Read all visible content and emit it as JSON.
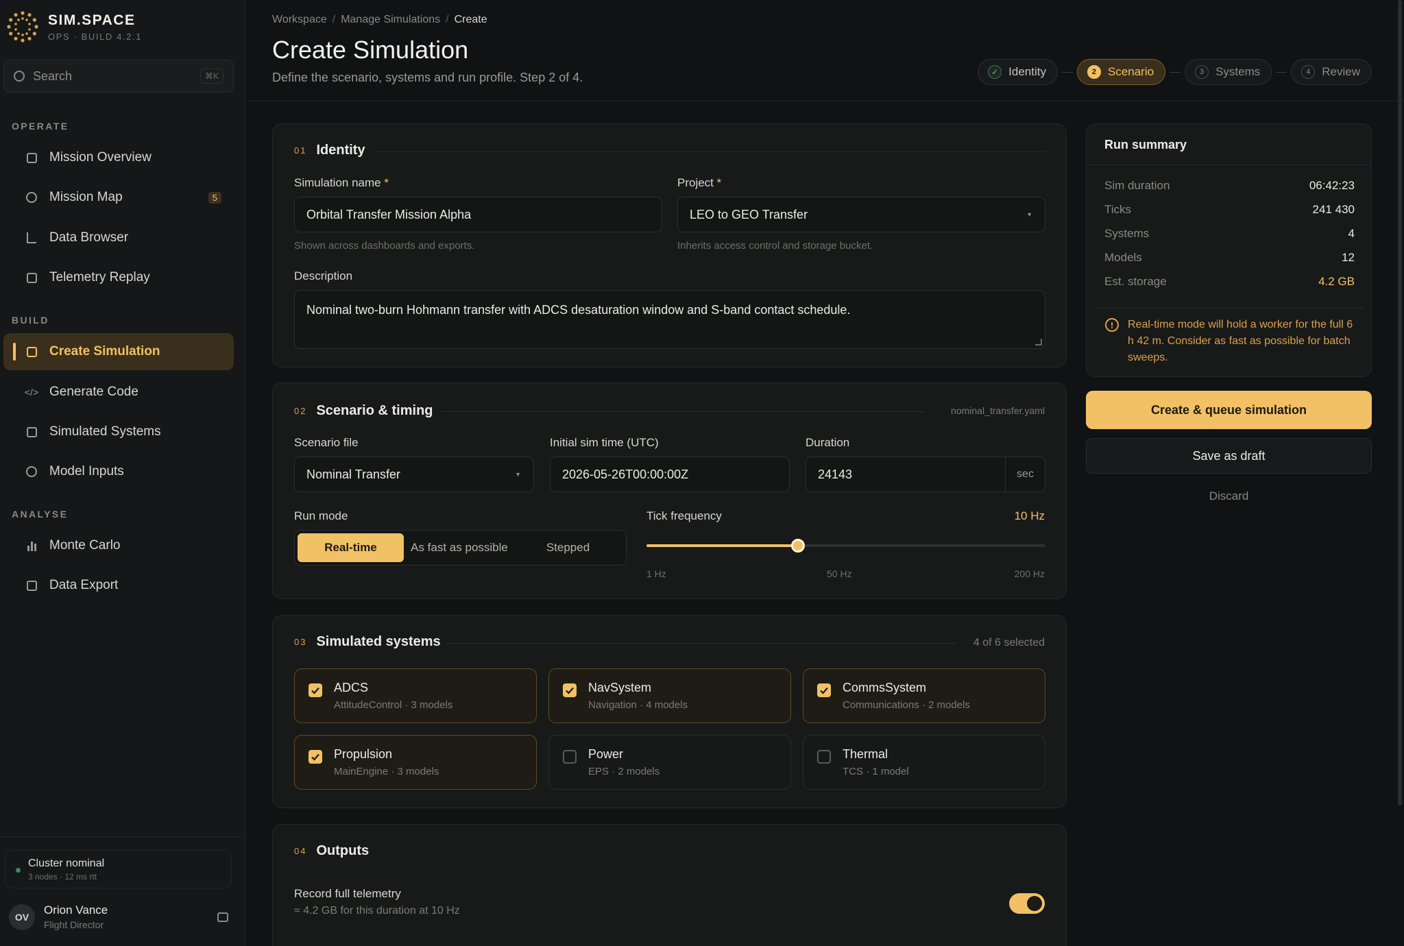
{
  "brand": {
    "name": "SIM.SPACE",
    "sub": "OPS · BUILD 4.2.1"
  },
  "search": {
    "placeholder": "Search",
    "shortcut": "⌘K"
  },
  "nav": {
    "operate": "OPERATE",
    "build": "BUILD",
    "analyse": "ANALYSE",
    "items": [
      {
        "label": "Mission Overview",
        "icon": "square-icon"
      },
      {
        "label": "Mission Map",
        "icon": "circle-icon",
        "badge": "5"
      },
      {
        "label": "Data Browser",
        "icon": "corner-icon"
      },
      {
        "label": "Telemetry Replay",
        "icon": "square-icon"
      },
      {
        "label": "Create Simulation",
        "icon": "square-icon",
        "active": true
      },
      {
        "label": "Generate Code",
        "icon": "code-icon",
        "icon_glyph": "</>"
      },
      {
        "label": "Simulated Systems",
        "icon": "square-icon"
      },
      {
        "label": "Model Inputs",
        "icon": "circle-icon"
      },
      {
        "label": "Monte Carlo",
        "icon": "bar-chart-icon"
      },
      {
        "label": "Data Export",
        "icon": "square-icon"
      }
    ]
  },
  "cluster": {
    "title": "Cluster nominal",
    "sub": "3 nodes · 12 ms rtt",
    "status_color": "#3b8d5a"
  },
  "user": {
    "initials": "OV",
    "name": "Orion Vance",
    "role": "Flight Director"
  },
  "breadcrumb": [
    "Workspace",
    "Manage Simulations",
    "Create"
  ],
  "page": {
    "title": "Create Simulation",
    "subtitle": "Define the scenario, systems and run profile. Step 2 of 4."
  },
  "steps": [
    {
      "num": "✓",
      "label": "Identity",
      "state": "done"
    },
    {
      "num": "2",
      "label": "Scenario",
      "state": "current"
    },
    {
      "num": "3",
      "label": "Systems",
      "state": "upcoming"
    },
    {
      "num": "4",
      "label": "Review",
      "state": "upcoming"
    }
  ],
  "identity": {
    "num": "01",
    "title": "Identity",
    "name_label": "Simulation name",
    "name_value": "Orbital Transfer Mission Alpha",
    "name_hint": "Shown across dashboards and exports.",
    "project_label": "Project",
    "project_value": "LEO to GEO Transfer",
    "project_hint": "Inherits access control and storage bucket.",
    "desc_label": "Description",
    "desc_value": "Nominal two-burn Hohmann transfer with ADCS desaturation window and S-band contact schedule.",
    "required_mark": "*"
  },
  "scenario": {
    "num": "02",
    "title": "Scenario & timing",
    "file_meta": "nominal_transfer.yaml",
    "file_label": "Scenario file",
    "file_value": "Nominal Transfer",
    "time_label": "Initial sim time (UTC)",
    "time_value": "2026-05-26T00:00:00Z",
    "duration_label": "Duration",
    "duration_value": "24143",
    "duration_unit": "sec",
    "mode_label": "Run mode",
    "modes": [
      "Real-time",
      "As fast as possible",
      "Stepped"
    ],
    "mode_selected": "Real-time",
    "tick_label": "Tick frequency",
    "tick_value": "10 Hz",
    "tick_fraction": 0.38,
    "tick_marks": [
      "1 Hz",
      "50 Hz",
      "200 Hz"
    ]
  },
  "systems": {
    "num": "03",
    "title": "Simulated systems",
    "meta": "4 of 6 selected",
    "items": [
      {
        "name": "ADCS",
        "sub": "AttitudeControl · 3 models",
        "selected": true
      },
      {
        "name": "NavSystem",
        "sub": "Navigation · 4 models",
        "selected": true
      },
      {
        "name": "CommsSystem",
        "sub": "Communications · 2 models",
        "selected": true
      },
      {
        "name": "Propulsion",
        "sub": "MainEngine · 3 models",
        "selected": true
      },
      {
        "name": "Power",
        "sub": "EPS · 2 models",
        "selected": false
      },
      {
        "name": "Thermal",
        "sub": "TCS · 1 model",
        "selected": false
      }
    ]
  },
  "outputs": {
    "num": "04",
    "title": "Outputs",
    "telemetry_label": "Record full telemetry",
    "telemetry_sub": "≈ 4.2 GB for this duration at 10 Hz",
    "telemetry_on": true
  },
  "summary": {
    "title": "Run summary",
    "rows": [
      {
        "k": "Sim duration",
        "v": "06:42:23"
      },
      {
        "k": "Ticks",
        "v": "241 430"
      },
      {
        "k": "Systems",
        "v": "4"
      },
      {
        "k": "Models",
        "v": "12"
      },
      {
        "k": "Est. storage",
        "v": "4.2 GB",
        "accent": true
      }
    ],
    "warning": "Real-time mode will hold a worker for the full 6 h 42 m. Consider as fast as possible for batch sweeps."
  },
  "actions": {
    "primary": "Create & queue simulation",
    "secondary": "Save as draft",
    "discard": "Discard"
  },
  "colors": {
    "accent": "#f2c165",
    "background": "#111213",
    "panel": "#181919"
  }
}
